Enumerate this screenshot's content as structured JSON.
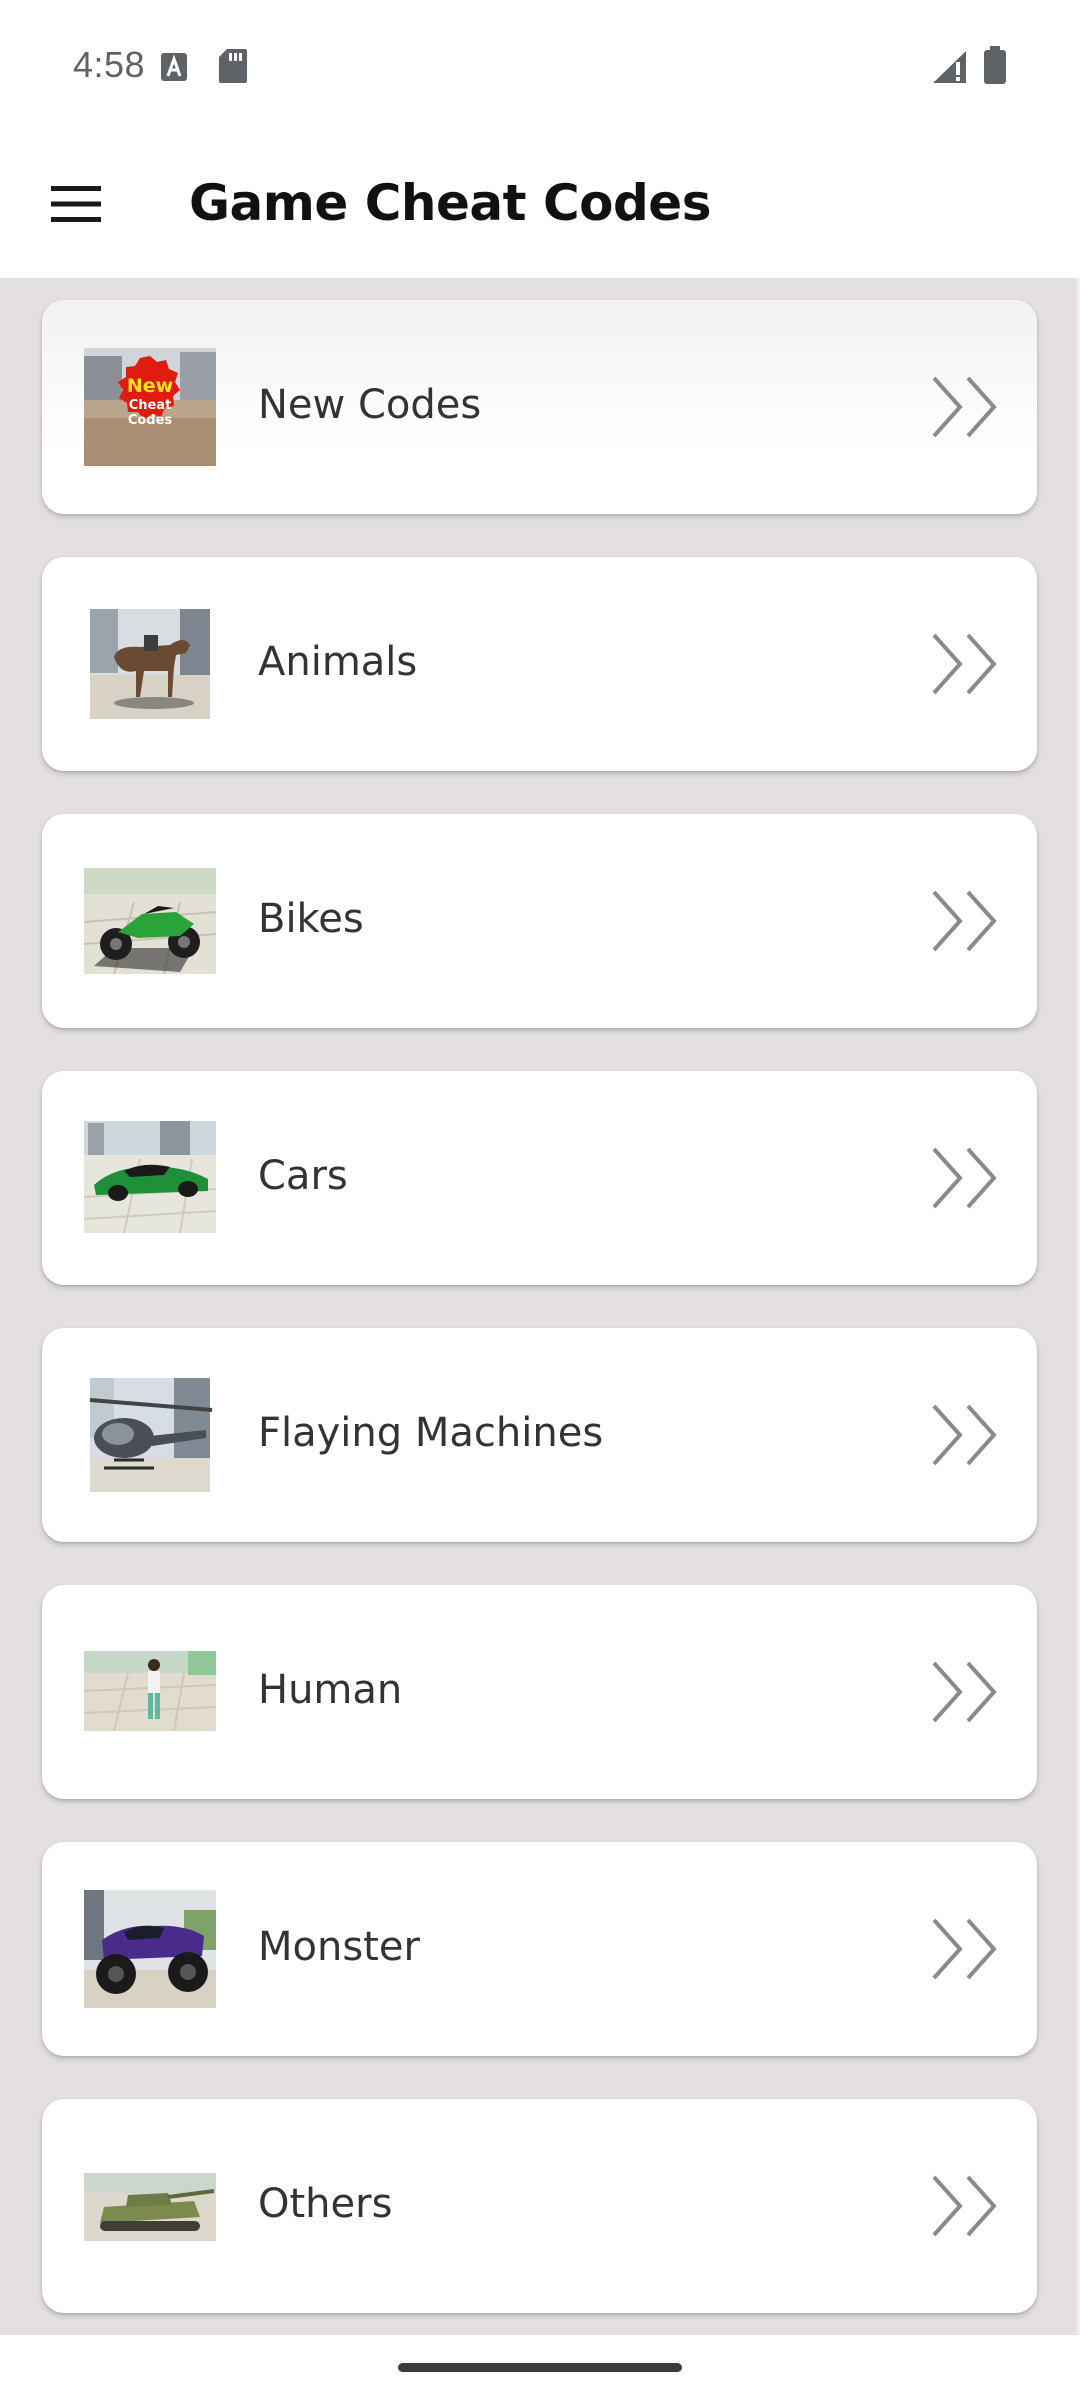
{
  "status_bar": {
    "time": "4:58",
    "left_icons": [
      "text-input-icon",
      "sd-card-icon"
    ],
    "right_icons": [
      "signal-icon",
      "battery-icon"
    ]
  },
  "app_bar": {
    "menu_icon": "hamburger-menu-icon",
    "title": "Game Cheat Codes"
  },
  "categories": [
    {
      "label": "New Codes",
      "thumb": "new-codes-image",
      "badge_lines": [
        "New",
        "Cheat",
        "Codes"
      ]
    },
    {
      "label": "Animals",
      "thumb": "horse-image"
    },
    {
      "label": "Bikes",
      "thumb": "motorbike-image"
    },
    {
      "label": "Cars",
      "thumb": "sports-car-image"
    },
    {
      "label": "Flaying Machines",
      "thumb": "helicopter-image"
    },
    {
      "label": "Human",
      "thumb": "character-image"
    },
    {
      "label": "Monster",
      "thumb": "monster-truck-image"
    },
    {
      "label": "Others",
      "thumb": "tank-image"
    }
  ],
  "colors": {
    "list_background": "#e4e0e0",
    "card_background": "#ffffff",
    "chevron": "#8a8a8a",
    "text": "#333333"
  }
}
